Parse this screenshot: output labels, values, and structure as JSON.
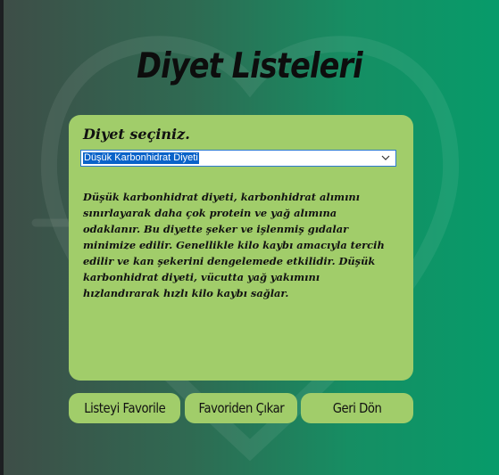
{
  "colors": {
    "panel": "#a1cd6a",
    "background_left": "#3e4d47",
    "background_right": "#079b6a",
    "selection": "#0a63c9"
  },
  "header": {
    "title": "Diyet Listeleri"
  },
  "diet_panel": {
    "prompt_label": "Diyet seçiniz.",
    "dropdown": {
      "selected": "Düşük Karbonhidrat Diyeti",
      "icon": "chevron-down-icon"
    },
    "description": "Düşük karbonhidrat diyeti, karbonhidrat alımını sınırlayarak daha çok protein ve yağ alımına odaklanır. Bu diyette şeker ve işlenmiş gıdalar minimize edilir. Genellikle kilo kaybı amacıyla tercih edilir ve kan şekerini dengelemede etkilidir. Düşük karbonhidrat diyeti, vücutta yağ yakımını hızlandırarak hızlı kilo kaybı sağlar."
  },
  "actions": {
    "add_favorite": "Listeyi Favorile",
    "remove_favorite": "Favoriden Çıkar",
    "back": "Geri Dön"
  }
}
